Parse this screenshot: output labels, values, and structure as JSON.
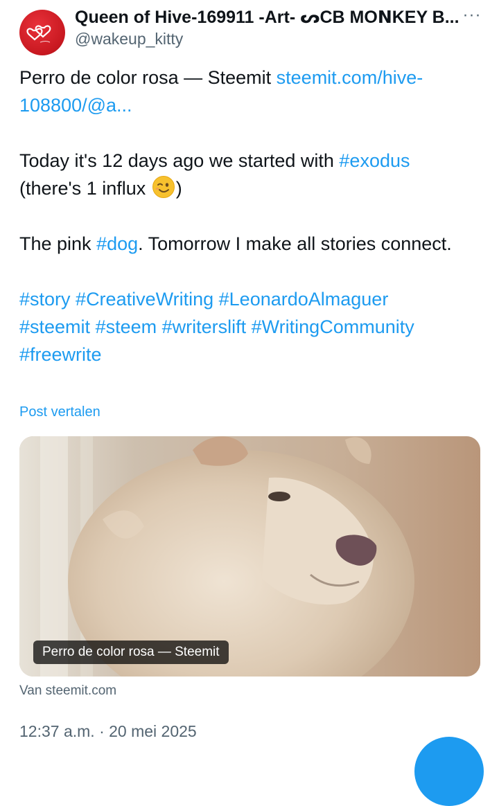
{
  "author": {
    "display_name": "Queen of Hive-169911 -Art- ᔕCB MOꓠKEY B...",
    "handle": "@wakeup_kitty",
    "avatar_icon": "hearts-logo-avatar",
    "avatar_color": "#d11f26"
  },
  "more_label": "···",
  "tweet": {
    "p1_text": "Perro de color rosa — Steemit ",
    "p1_link": "steemit.com/hive-108800/@a...",
    "p2_text": "Today it's 12 days ago we started with ",
    "p2_hashtag": "#exodus",
    "p2_line2": "(there's 1 influx ",
    "p2_close": ")",
    "p3_text": "The pink ",
    "p3_hashtag": "#dog",
    "p3_rest": ". Tomorrow I make all stories connect.",
    "hashtags": [
      "#story",
      "#CreativeWriting",
      "#LeonardoAlmaguer",
      "#steemit",
      "#steem",
      "#writerslift",
      "#WritingCommunity",
      "#freewrite"
    ]
  },
  "translate_label": "Post vertalen",
  "card": {
    "title": "Perro de color rosa — Steemit",
    "image_subject": "fluffy cream-colored dog in profile",
    "source": "Van steemit.com"
  },
  "timestamp": "12:37 a.m. · 20 mei 2025",
  "colors": {
    "link": "#1d9bf0",
    "text": "#0f1419",
    "secondary": "#536471"
  }
}
